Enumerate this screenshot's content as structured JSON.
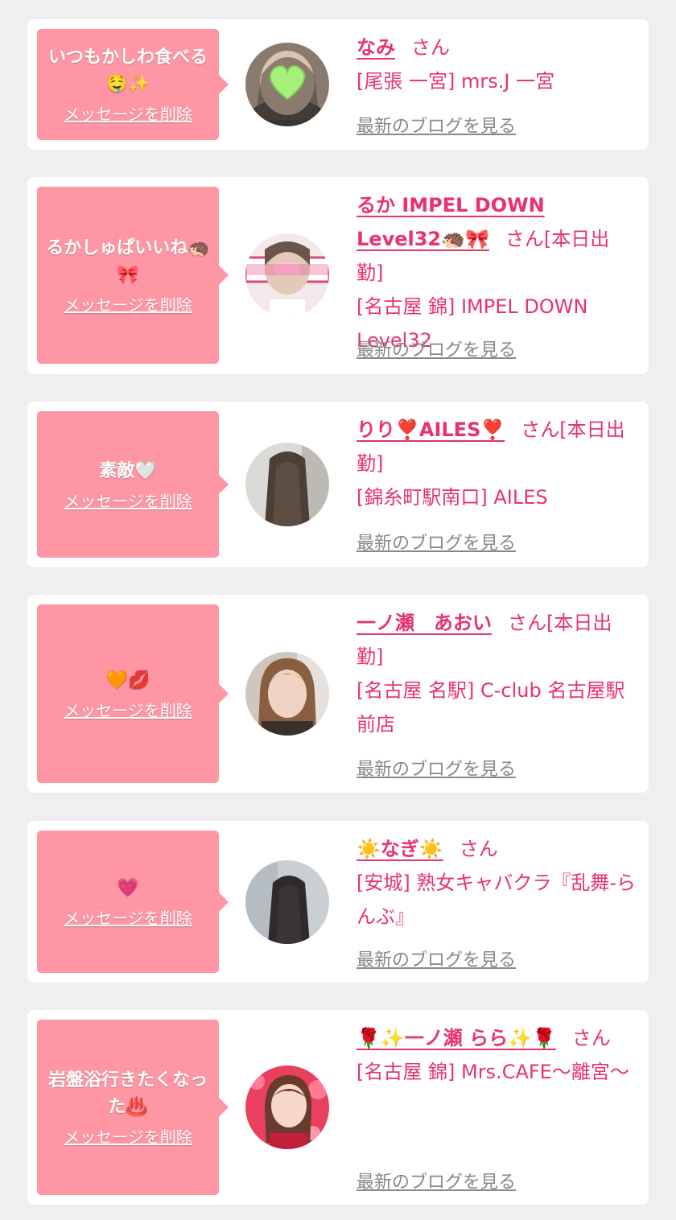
{
  "colors": {
    "page_bg": "#efefef",
    "card_bg": "#ffffff",
    "bubble_bg": "#ff96a4",
    "accent": "#e8336d",
    "link_gray": "#888888"
  },
  "messages": [
    {
      "message": "いつもかしわ食べる🤤✨",
      "delete_label": "メッセージを削除",
      "cast_name": "なみ",
      "honorific": "さん",
      "status": "",
      "shop": "[尾張 一宮] mrs.J 一宮",
      "blog_label": "最新のブログを見る"
    },
    {
      "message": "るかしゅぱいいね🦔🎀",
      "delete_label": "メッセージを削除",
      "cast_name": "るか IMPEL DOWN Level32🦔🎀",
      "honorific": "さん",
      "status": "[本日出勤]",
      "shop": "[名古屋 錦] IMPEL DOWN Level32",
      "blog_label": "最新のブログを見る"
    },
    {
      "message": "素敵🤍",
      "delete_label": "メッセージを削除",
      "cast_name": "りり❣️AILES❣️",
      "honorific": "さん",
      "status": "[本日出勤]",
      "shop": "[錦糸町駅南口] AILES",
      "blog_label": "最新のブログを見る"
    },
    {
      "message": "🧡💋",
      "delete_label": "メッセージを削除",
      "cast_name": "一ノ瀬　あおい",
      "honorific": "さん",
      "status": "[本日出勤]",
      "shop": "[名古屋 名駅] C-club 名古屋駅前店",
      "blog_label": "最新のブログを見る"
    },
    {
      "message": "💗",
      "delete_label": "メッセージを削除",
      "cast_name": "☀️なぎ☀️",
      "honorific": "さん",
      "status": "",
      "shop": "[安城] 熟女キャバクラ『乱舞-らんぶ』",
      "blog_label": "最新のブログを見る"
    },
    {
      "message": "岩盤浴行きたくなった♨️",
      "delete_label": "メッセージを削除",
      "cast_name": "🌹✨一ノ瀬 らら✨🌹",
      "honorific": "さん",
      "status": "",
      "shop": "[名古屋 錦] Mrs.CAFE〜離宮〜",
      "blog_label": "最新のブログを見る"
    }
  ]
}
